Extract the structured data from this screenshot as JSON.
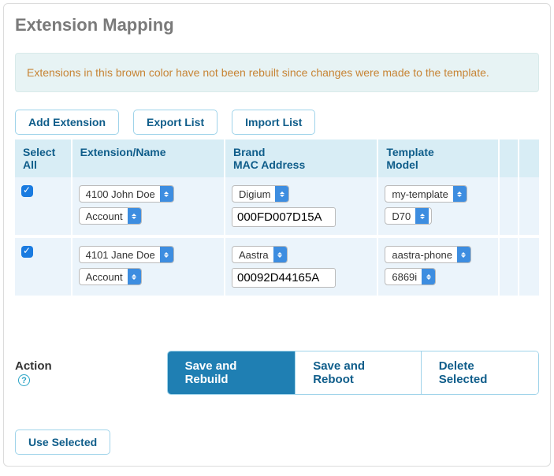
{
  "title": "Extension Mapping",
  "notice": "Extensions in this brown color have not been rebuilt since changes were made to the template.",
  "toolbar": {
    "add": "Add Extension",
    "export": "Export List",
    "import": "Import List"
  },
  "columns": {
    "select": "Select All",
    "ext": "Extension/Name",
    "brand_line1": "Brand",
    "brand_line2": "MAC Address",
    "tmpl_line1": "Template",
    "tmpl_line2": "Model"
  },
  "rows": [
    {
      "checked": true,
      "ext": "4100 John Doe",
      "account": "Account",
      "brand": "Digium",
      "mac": "000FD007D15A",
      "template": "my-template",
      "model": "D70"
    },
    {
      "checked": true,
      "ext": "4101 Jane Doe",
      "account": "Account",
      "brand": "Aastra",
      "mac": "00092D44165A",
      "template": "aastra-phone",
      "model": "6869i"
    }
  ],
  "action": {
    "label": "Action",
    "help": "?",
    "save_rebuild": "Save and Rebuild",
    "save_reboot": "Save and Reboot",
    "delete": "Delete Selected"
  },
  "footer": {
    "use_selected": "Use Selected"
  }
}
